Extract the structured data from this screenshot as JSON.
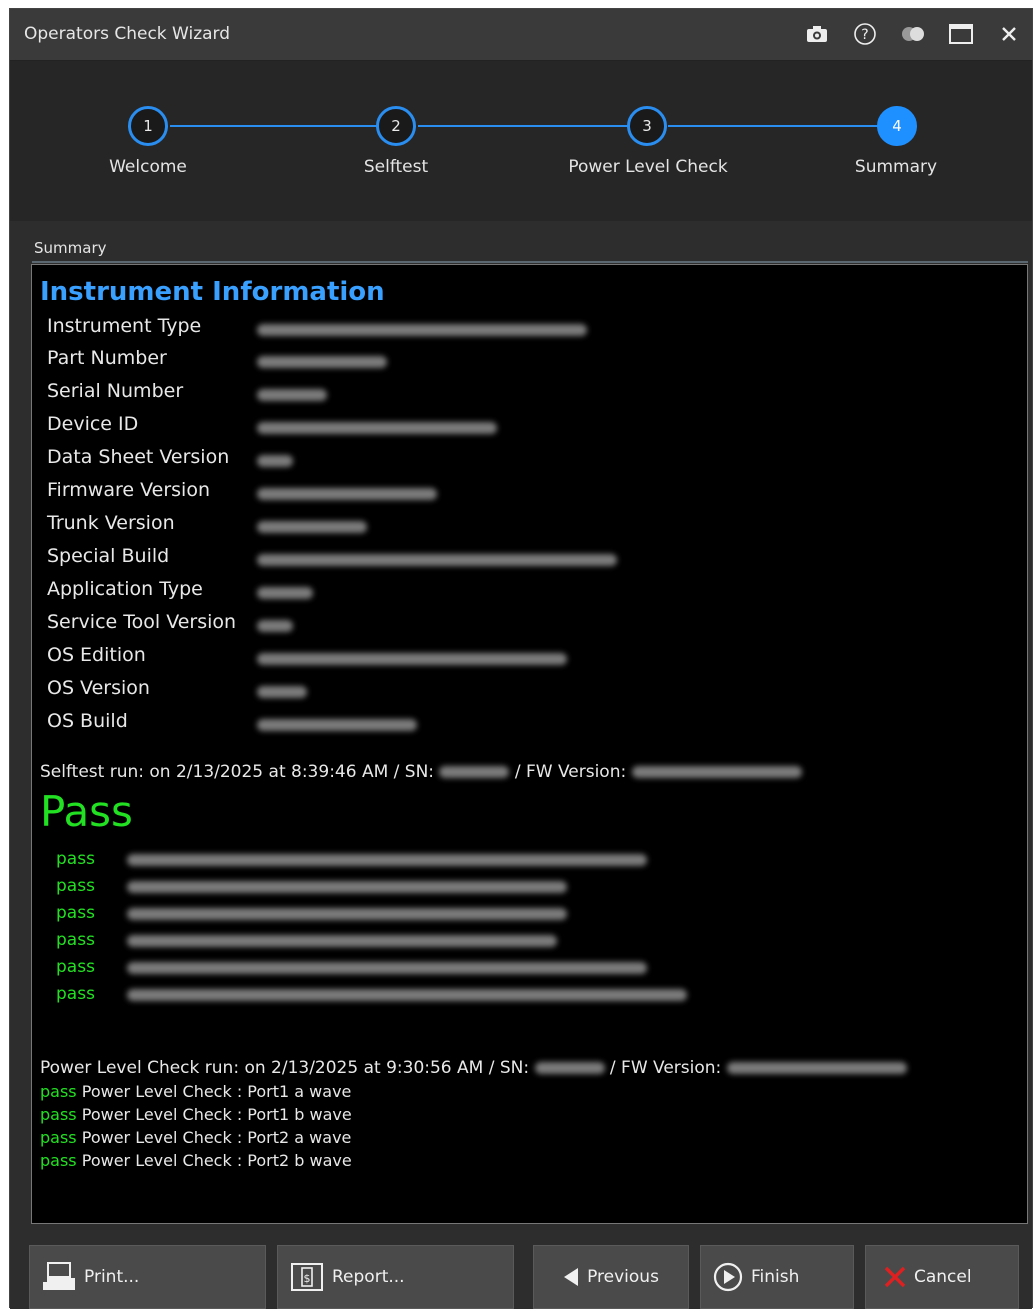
{
  "window": {
    "title": "Operators Check Wizard"
  },
  "titlebar_icons": [
    "camera-icon",
    "help-icon",
    "toggle-icon",
    "maximize-icon",
    "close-icon"
  ],
  "steps": [
    {
      "number": "1",
      "label": "Welcome",
      "active": false
    },
    {
      "number": "2",
      "label": "Selftest",
      "active": false
    },
    {
      "number": "3",
      "label": "Power Level Check",
      "active": false
    },
    {
      "number": "4",
      "label": "Summary",
      "active": true
    }
  ],
  "section": {
    "label": "Summary"
  },
  "report": {
    "heading": "Instrument Information",
    "info_keys": [
      "Instrument Type",
      "Part Number",
      "Serial Number",
      "Device ID",
      "Data Sheet Version",
      "Firmware Version",
      "Trunk Version",
      "Special Build",
      "Application Type",
      "Service Tool Version",
      "OS Edition",
      "OS Version",
      "OS Build"
    ],
    "selftest": {
      "run_prefix": "Selftest run: on 2/13/2025 at 8:39:46 AM / SN:",
      "fw_label": "/ FW Version:",
      "result": "Pass",
      "rows": [
        "pass",
        "pass",
        "pass",
        "pass",
        "pass",
        "pass"
      ]
    },
    "power_level": {
      "run_prefix": "Power Level Check run: on 2/13/2025 at 9:30:56 AM / SN:",
      "fw_label": "/ FW Version:",
      "rows": [
        {
          "status": "pass",
          "text": "Power Level Check : Port1 a wave"
        },
        {
          "status": "pass",
          "text": "Power Level Check : Port1 b wave"
        },
        {
          "status": "pass",
          "text": "Power Level Check : Port2 a wave"
        },
        {
          "status": "pass",
          "text": "Power Level Check : Port2 b wave"
        }
      ]
    }
  },
  "buttons": {
    "print": "Print...",
    "report": "Report...",
    "previous": "Previous",
    "finish": "Finish",
    "cancel": "Cancel"
  },
  "colors": {
    "accent": "#1e90ff",
    "heading": "#3aa0ff",
    "pass": "#22e022",
    "cancel_icon": "#e02020"
  }
}
